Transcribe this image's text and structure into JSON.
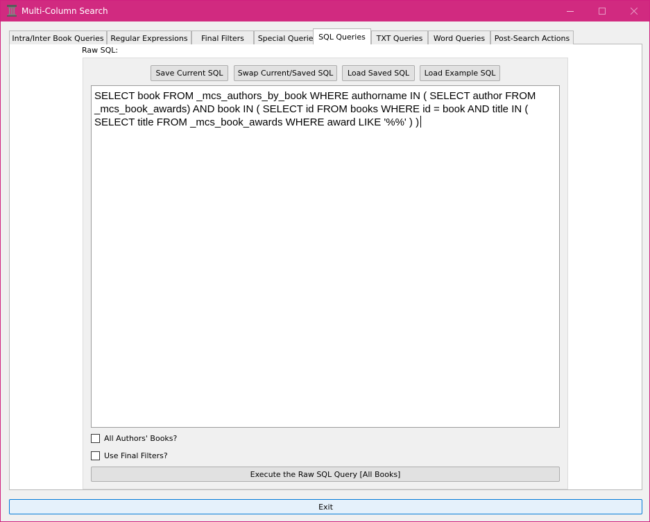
{
  "window": {
    "title": "Multi-Column Search",
    "accent_color": "#d12a80",
    "icon": "pillar-icon"
  },
  "tabs": [
    {
      "label": "Intra/Inter Book Queries",
      "active": false
    },
    {
      "label": "Regular Expressions",
      "active": false
    },
    {
      "label": "Final Filters",
      "active": false
    },
    {
      "label": "Special Queries",
      "active": false
    },
    {
      "label": "SQL Queries",
      "active": true
    },
    {
      "label": "TXT Queries",
      "active": false
    },
    {
      "label": "Word Queries",
      "active": false
    },
    {
      "label": "Post-Search Actions",
      "active": false
    }
  ],
  "sql_panel": {
    "raw_sql_label": "Raw SQL:",
    "buttons": {
      "save_current": "Save Current SQL",
      "swap": "Swap Current/Saved SQL",
      "load_saved": "Load Saved SQL",
      "load_example": "Load Example SQL"
    },
    "query_text": "SELECT book FROM _mcs_authors_by_book WHERE authorname IN ( SELECT author FROM _mcs_book_awards) AND book IN ( SELECT id FROM books WHERE id = book AND title IN ( SELECT title FROM _mcs_book_awards WHERE award LIKE '%%' ) )",
    "all_authors_books": {
      "label": "All Authors' Books?",
      "checked": false
    },
    "use_final_filters": {
      "label": "Use Final Filters?",
      "checked": false
    },
    "execute_label": "Execute the Raw SQL Query [All Books]"
  },
  "footer": {
    "exit_label": "Exit"
  }
}
